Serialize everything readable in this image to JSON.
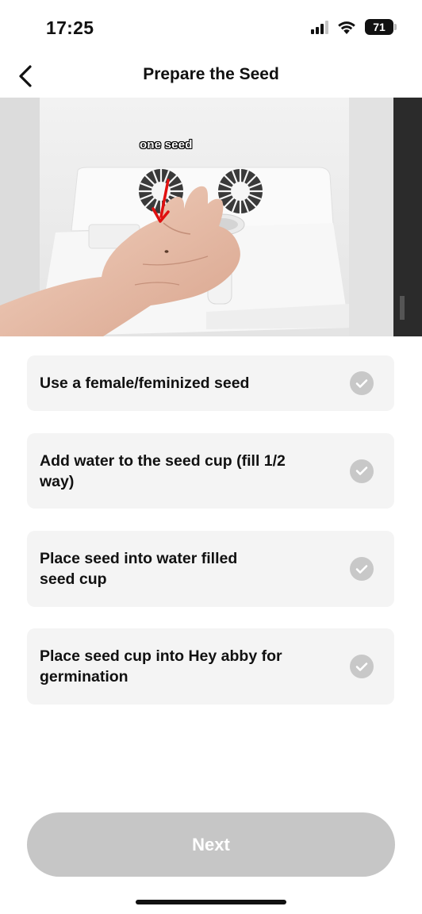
{
  "status_bar": {
    "time": "17:25",
    "battery": "71",
    "icons": [
      "signal-icon",
      "wifi-icon",
      "battery-icon"
    ]
  },
  "nav": {
    "title": "Prepare the Seed",
    "back_icon": "chevron-left-icon"
  },
  "hero": {
    "caption": "one seed",
    "annotation_color": "#e01010"
  },
  "steps": [
    {
      "label": "Use a female/feminized seed",
      "icon": "check-circle-icon"
    },
    {
      "label": "Add water to the seed cup (fill 1/2 way)",
      "icon": "check-circle-icon"
    },
    {
      "label": "Place seed into water filled seed cup",
      "icon": "check-circle-icon"
    },
    {
      "label": "Place seed cup into Hey abby for germination",
      "icon": "check-circle-icon"
    }
  ],
  "next_button": {
    "label": "Next",
    "enabled": false
  },
  "colors": {
    "card_background": "#f4f4f4",
    "check_inactive": "#c8c8c8",
    "button_disabled": "#c6c6c6"
  }
}
